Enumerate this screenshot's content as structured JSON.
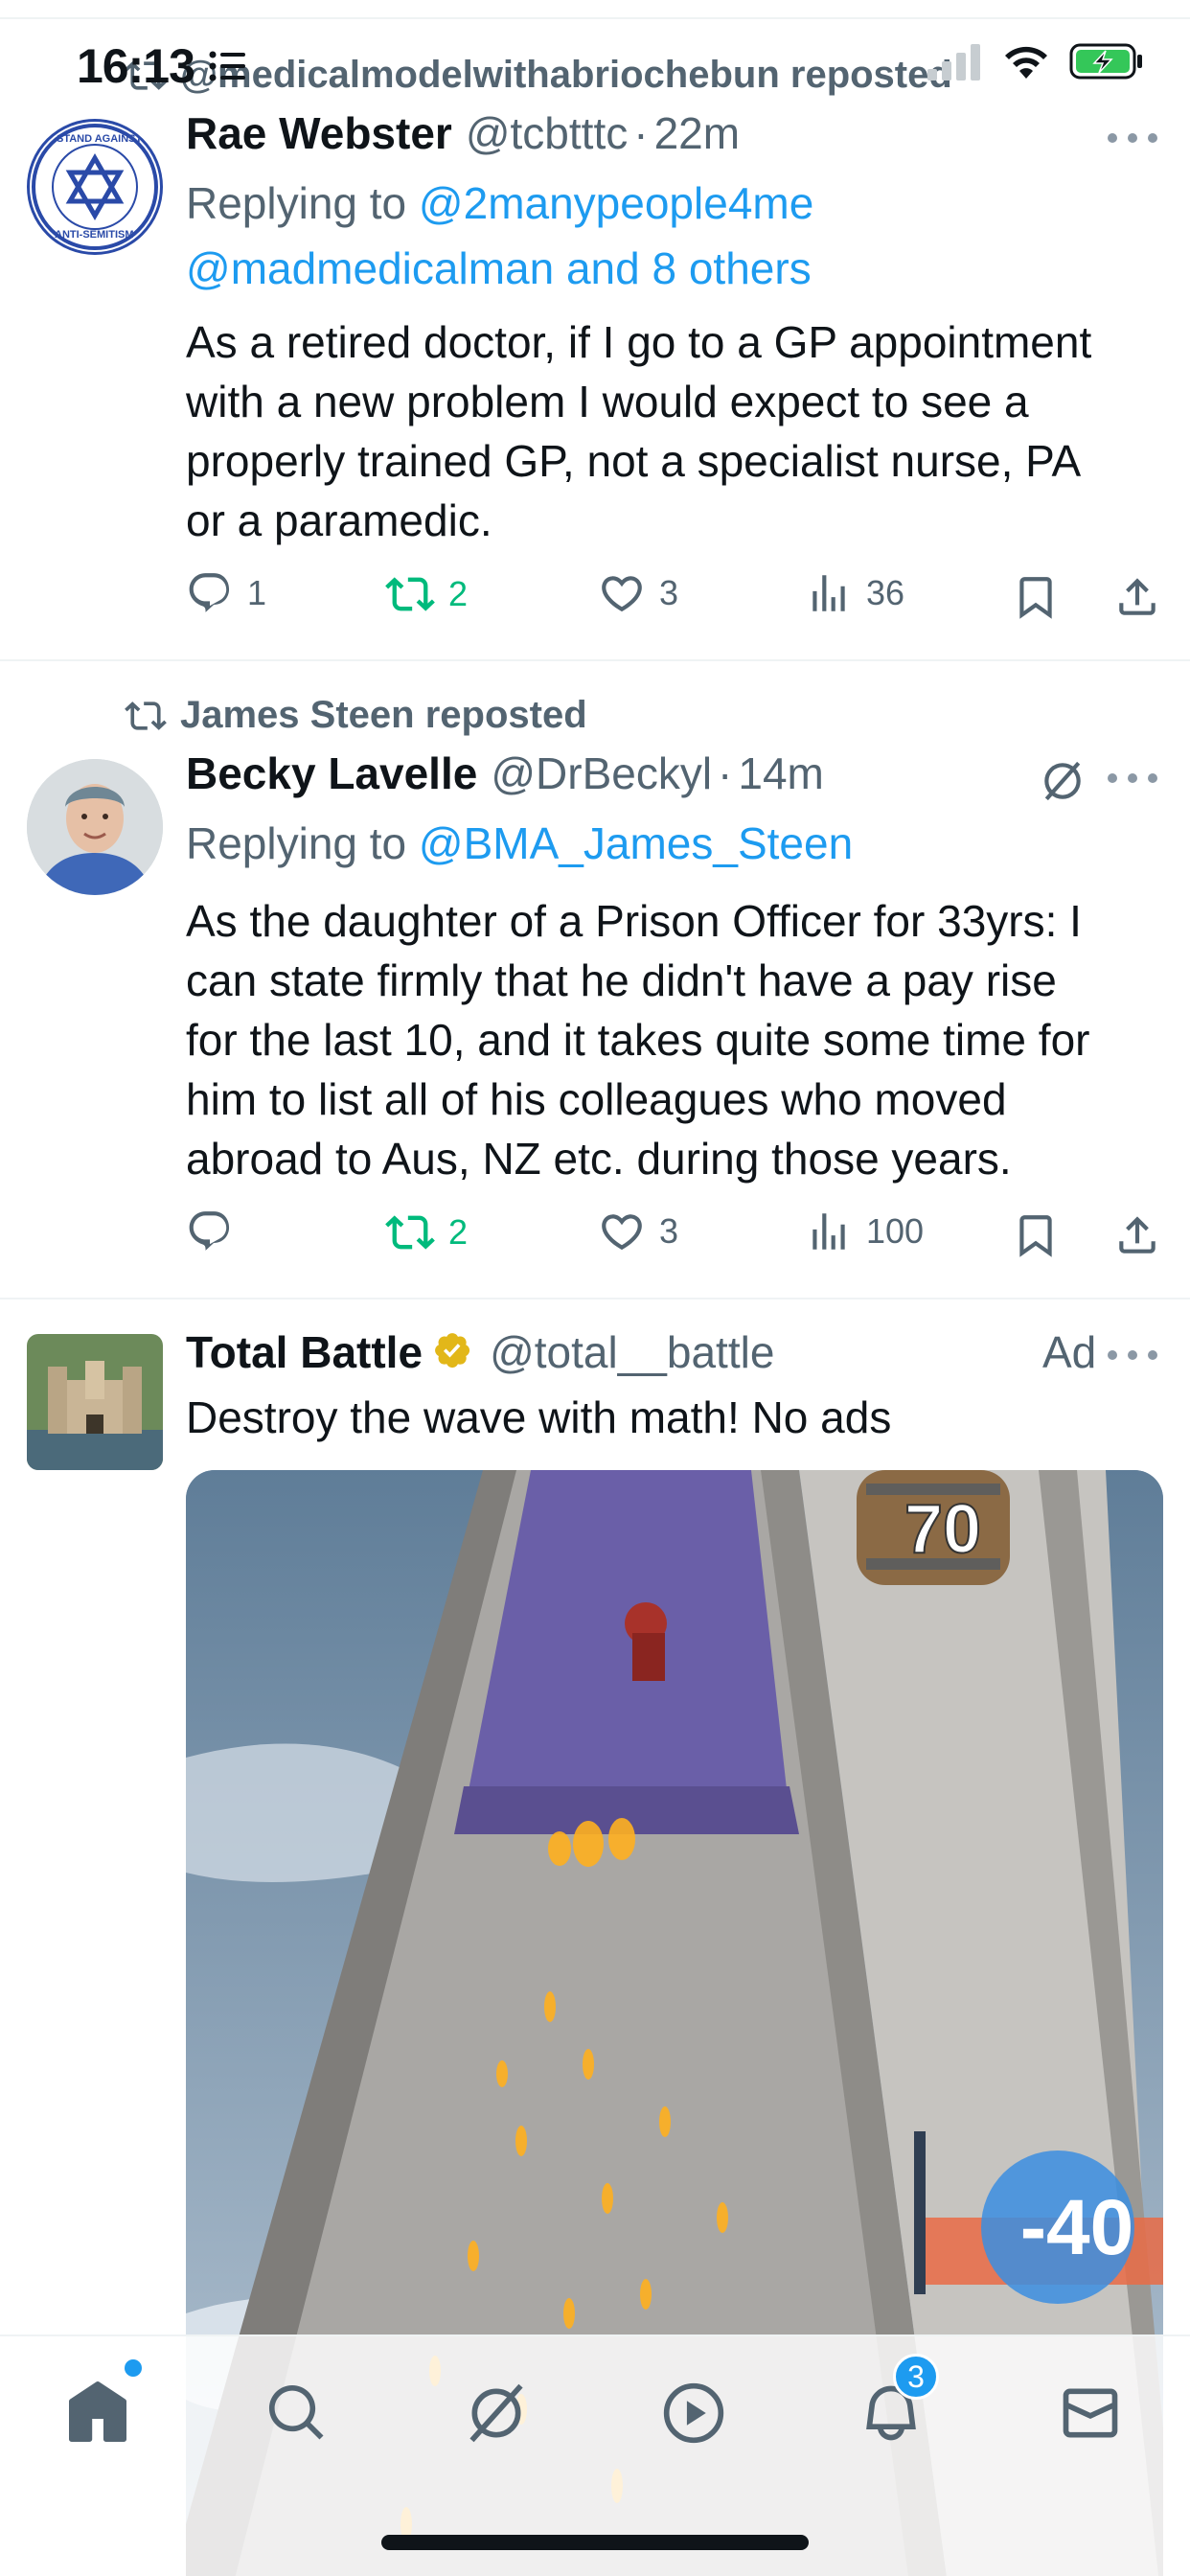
{
  "status_bar": {
    "time": "16:13"
  },
  "tweets": [
    {
      "repost_by": "@medicalmodelwithabriochebun reposted",
      "name": "Rae Webster",
      "handle": "@tcbtttc",
      "time": "22m",
      "replying_label": "Replying to ",
      "replying_1": "@2manypeople4me",
      "replying_2": "@madmedicalman and 8 others",
      "avatar_text_top": "STAND AGAINST",
      "avatar_text_bottom": "ANTI-SEMITISM",
      "text_lines": [
        "As a retired doctor, if I go to a GP appointment",
        "with a new problem I would expect to see a",
        "properly trained GP, not a specialist nurse, PA",
        "or a paramedic."
      ],
      "replies": "1",
      "reposts": "2",
      "likes": "3",
      "views": "36"
    },
    {
      "repost_by": "James Steen reposted",
      "name": "Becky Lavelle",
      "handle": "@DrBeckyl",
      "time": "14m",
      "replying_label": "Replying to ",
      "replying_1": "@BMA_James_Steen",
      "text_lines": [
        "As the daughter of a Prison Officer for 33yrs: I",
        "can state firmly that he didn't have a pay rise",
        "for the last 10, and it takes quite some time for",
        "him to list all of his colleagues who moved",
        "abroad to Aus, NZ etc. during those years."
      ],
      "replies": "",
      "reposts": "2",
      "likes": "3",
      "views": "100"
    },
    {
      "name": "Total Battle",
      "handle": "@total__battle",
      "ad_label": "Ad",
      "text": "Destroy the wave with math! No ads",
      "media": {
        "barrel_number": "70",
        "gate_value": "-40"
      }
    }
  ],
  "tabbar": {
    "notifications_badge": "3"
  },
  "colors": {
    "accent": "#1d9bf0",
    "repost_green": "#00ba7c",
    "muted": "#536471"
  }
}
